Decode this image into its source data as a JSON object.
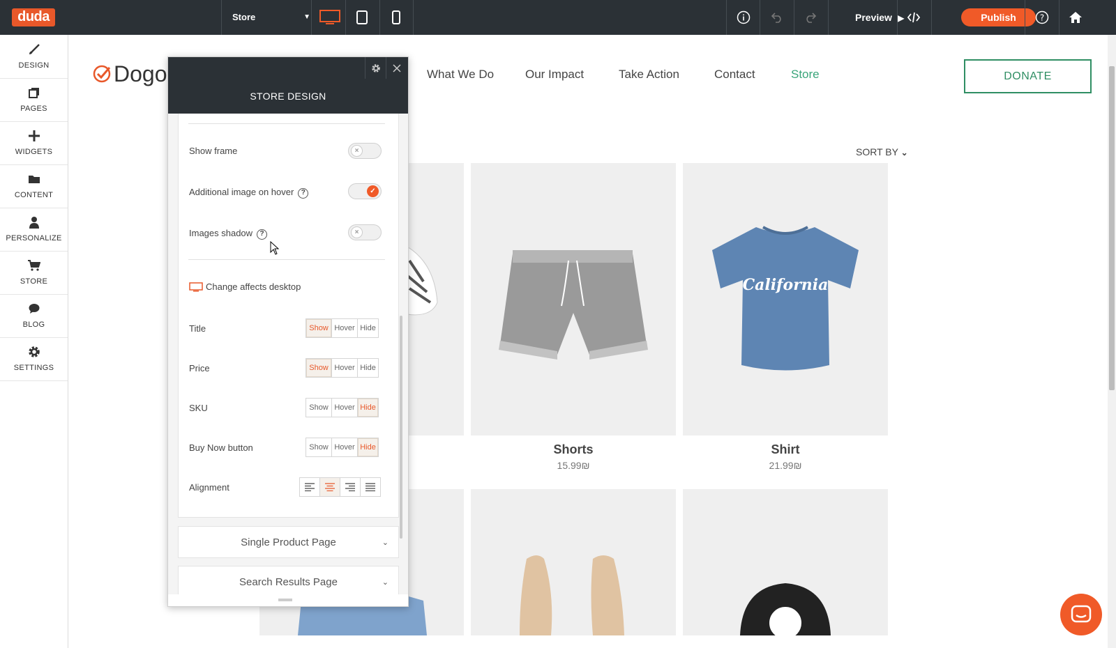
{
  "topbar": {
    "logo": "duda",
    "page_select": "Store",
    "preview_label": "Preview",
    "publish_label": "Publish"
  },
  "sidebar": {
    "items": [
      {
        "label": "DESIGN",
        "icon": "brush-icon"
      },
      {
        "label": "PAGES",
        "icon": "pages-icon"
      },
      {
        "label": "WIDGETS",
        "icon": "plus-icon"
      },
      {
        "label": "CONTENT",
        "icon": "folder-icon"
      },
      {
        "label": "PERSONALIZE",
        "icon": "person-icon"
      },
      {
        "label": "STORE",
        "icon": "cart-icon"
      },
      {
        "label": "BLOG",
        "icon": "chat-bubble-icon"
      },
      {
        "label": "SETTINGS",
        "icon": "gear-icon"
      }
    ]
  },
  "site": {
    "brand": "Dogo",
    "nav": [
      "What We Do",
      "Our Impact",
      "Take Action",
      "Contact",
      "Store"
    ],
    "active_nav": "Store",
    "donate_label": "DONATE",
    "sort_label": "SORT BY",
    "products": [
      {
        "name": "Shorts",
        "price": "15.99₪"
      },
      {
        "name": "Shirt",
        "price": "21.99₪"
      }
    ]
  },
  "panel": {
    "title": "STORE DESIGN",
    "toggles": [
      {
        "label": "Show frame",
        "on": false,
        "help": false
      },
      {
        "label": "Additional image on hover",
        "on": true,
        "help": true
      },
      {
        "label": "Images shadow",
        "on": false,
        "help": true
      }
    ],
    "device_note": "Change affects desktop",
    "visibility_options": [
      "Show",
      "Hover",
      "Hide"
    ],
    "visibility_rows": [
      {
        "label": "Title",
        "selected": "Show"
      },
      {
        "label": "Price",
        "selected": "Show"
      },
      {
        "label": "SKU",
        "selected": "Hide"
      },
      {
        "label": "Buy Now button",
        "selected": "Hide"
      }
    ],
    "alignment_label": "Alignment",
    "alignment_selected": "center",
    "accordions": [
      "Single Product Page",
      "Search Results Page"
    ]
  },
  "colors": {
    "accent": "#f05a28",
    "topbar": "#2b3136",
    "brand_green": "#2f8e63"
  }
}
